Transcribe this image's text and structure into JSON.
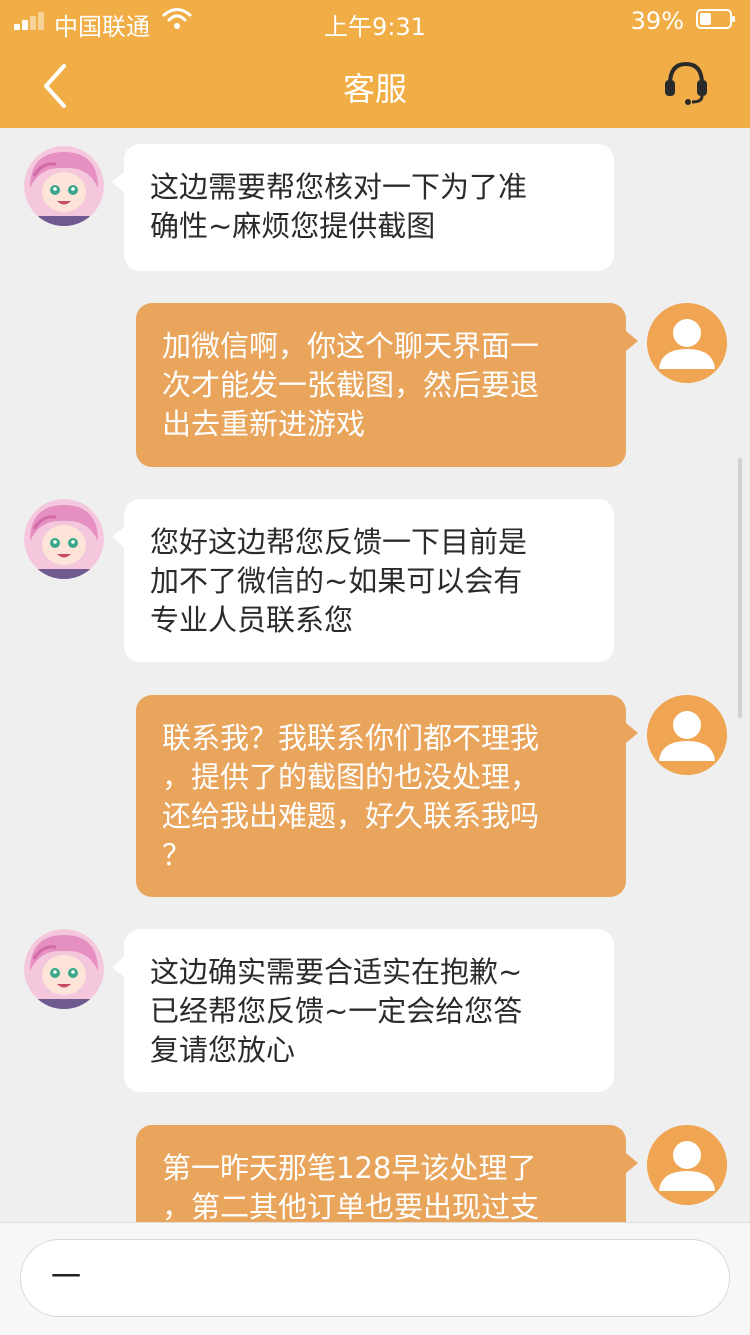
{
  "status_bar": {
    "carrier": "中国联通",
    "time": "上午9:31",
    "battery": "39%",
    "battery_level": 0.39
  },
  "navbar": {
    "title": "客服",
    "back_icon": "chevron-left-icon",
    "support_icon": "headset-icon"
  },
  "messages": [
    {
      "sender": "agent",
      "text": "这边需要帮您核对一下为了准\n确性~麻烦您提供截图"
    },
    {
      "sender": "user",
      "text": "加微信啊，你这个聊天界面一\n次才能发一张截图，然后要退\n出去重新进游戏"
    },
    {
      "sender": "agent",
      "text": "您好这边帮您反馈一下目前是\n加不了微信的~如果可以会有\n专业人员联系您"
    },
    {
      "sender": "user",
      "text": "联系我？我联系你们都不理我\n，提供了的截图的也没处理，\n还给我出难题，好久联系我吗\n？"
    },
    {
      "sender": "agent",
      "text": "这边确实需要合适实在抱歉~\n已经帮您反馈~一定会给您答\n复请您放心"
    },
    {
      "sender": "user",
      "text": "第一昨天那笔128早该处理了\n，第二其他订单也要出现过支"
    }
  ],
  "input": {
    "value": "一"
  },
  "colors": {
    "accent": "#f1ad46",
    "user_bubble": "#e9a55c",
    "agent_bubble": "#ffffff",
    "background": "#efeff0"
  }
}
